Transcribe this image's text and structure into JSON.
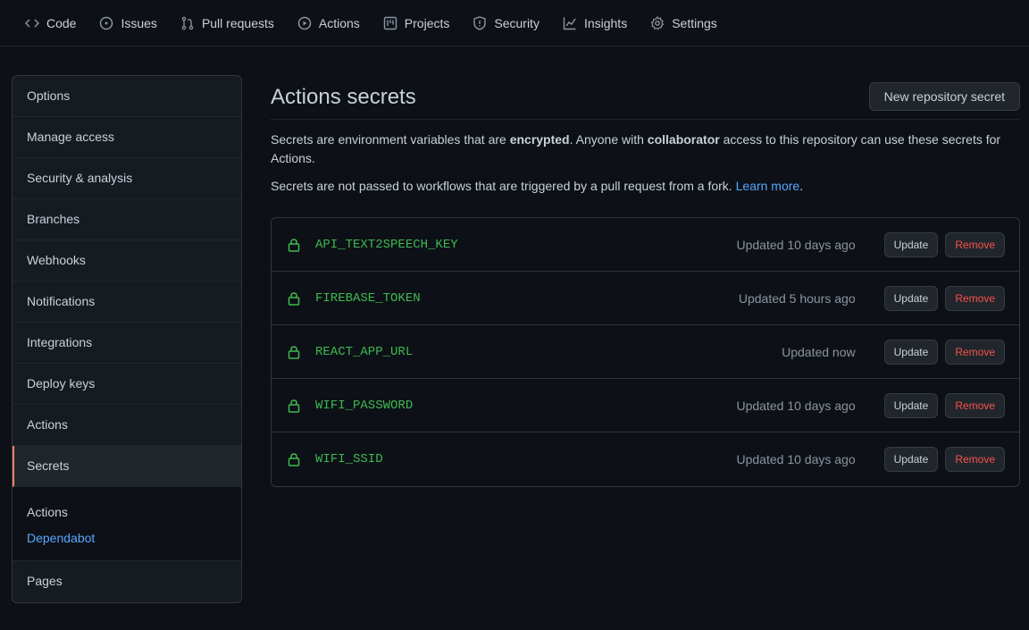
{
  "topnav": [
    {
      "label": "Code",
      "icon": "code-icon"
    },
    {
      "label": "Issues",
      "icon": "issue-icon"
    },
    {
      "label": "Pull requests",
      "icon": "pull-request-icon"
    },
    {
      "label": "Actions",
      "icon": "play-icon"
    },
    {
      "label": "Projects",
      "icon": "project-icon"
    },
    {
      "label": "Security",
      "icon": "shield-icon"
    },
    {
      "label": "Insights",
      "icon": "graph-icon"
    },
    {
      "label": "Settings",
      "icon": "gear-icon"
    }
  ],
  "sidebar": {
    "items": [
      "Options",
      "Manage access",
      "Security & analysis",
      "Branches",
      "Webhooks",
      "Notifications",
      "Integrations",
      "Deploy keys",
      "Actions",
      "Secrets"
    ],
    "sub_items": [
      "Actions",
      "Dependabot"
    ],
    "last_item": "Pages"
  },
  "main": {
    "title": "Actions secrets",
    "new_button": "New repository secret",
    "desc_part1": "Secrets are environment variables that are ",
    "desc_bold1": "encrypted",
    "desc_part2": ". Anyone with ",
    "desc_bold2": "collaborator",
    "desc_part3": " access to this repository can use these secrets for Actions.",
    "desc2_text": "Secrets are not passed to workflows that are triggered by a pull request from a fork. ",
    "learn_more": "Learn more",
    "desc2_end": "."
  },
  "secrets": [
    {
      "name": "API_TEXT2SPEECH_KEY",
      "updated": "Updated 10 days ago"
    },
    {
      "name": "FIREBASE_TOKEN",
      "updated": "Updated 5 hours ago"
    },
    {
      "name": "REACT_APP_URL",
      "updated": "Updated now"
    },
    {
      "name": "WIFI_PASSWORD",
      "updated": "Updated 10 days ago"
    },
    {
      "name": "WIFI_SSID",
      "updated": "Updated 10 days ago"
    }
  ],
  "buttons": {
    "update": "Update",
    "remove": "Remove"
  },
  "colors": {
    "accent_selected": "#f78166",
    "secret_name": "#3fb950",
    "danger": "#f85149",
    "link": "#58a6ff"
  }
}
